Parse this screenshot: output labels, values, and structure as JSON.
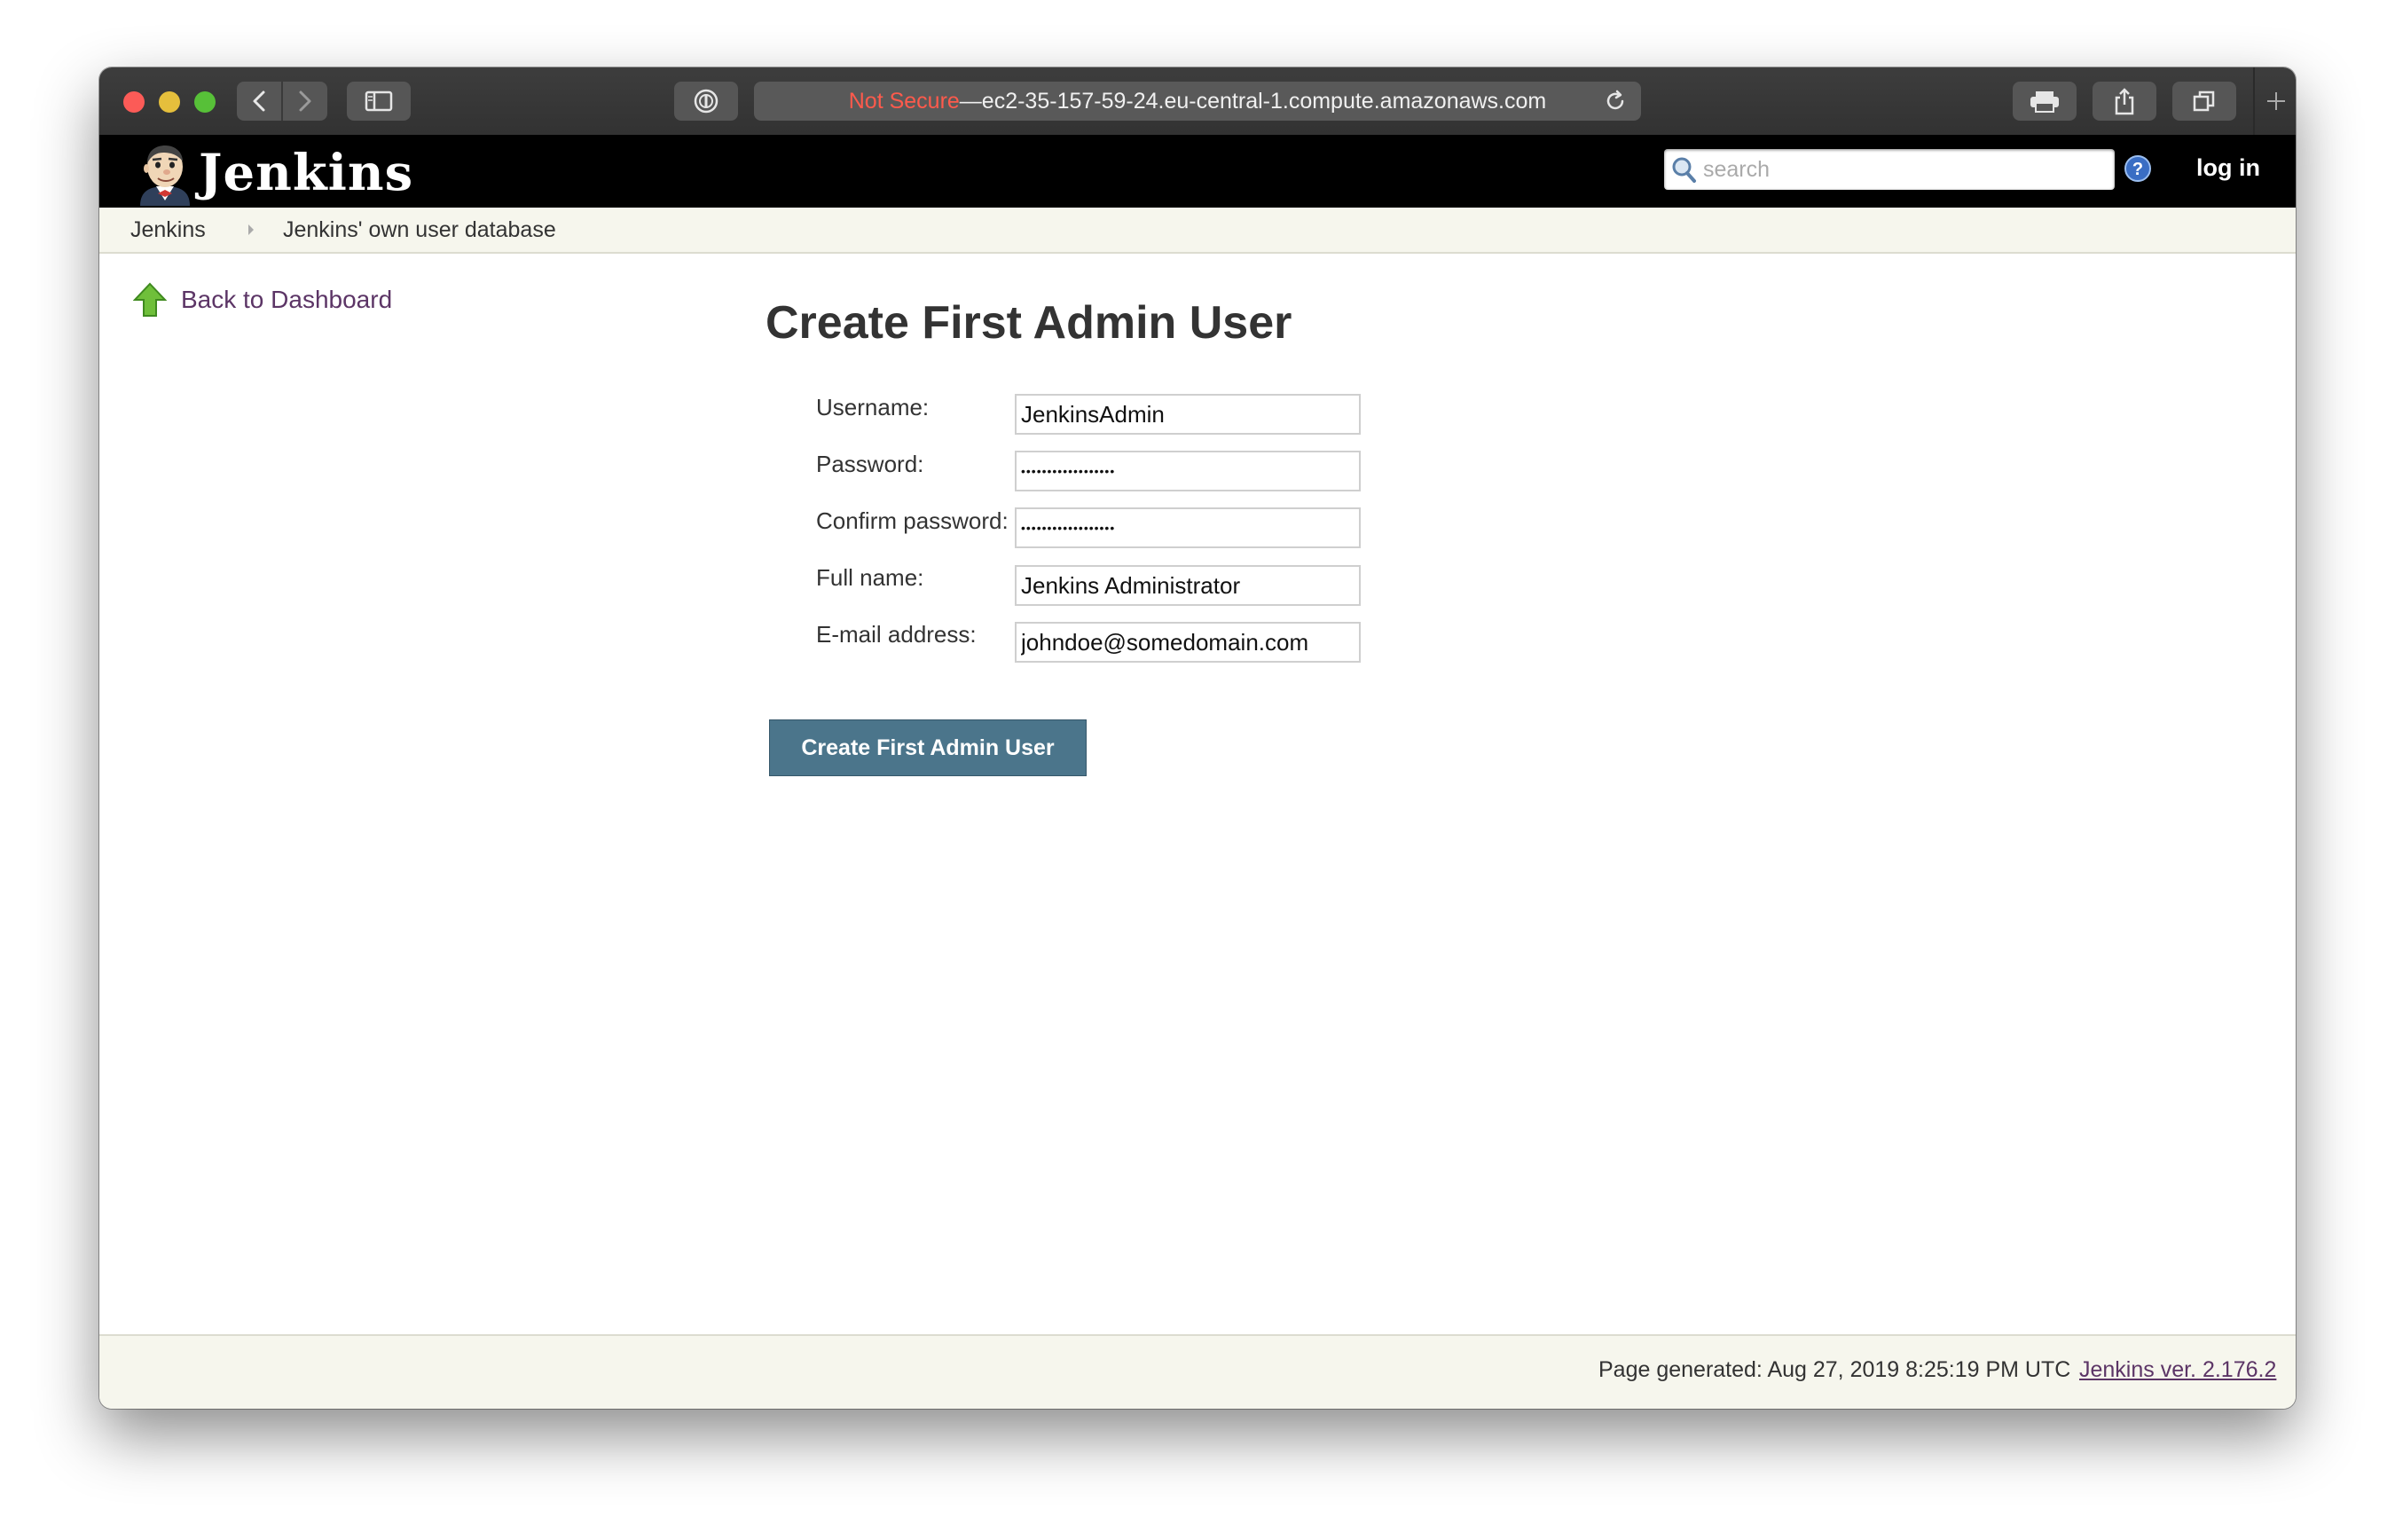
{
  "browser": {
    "url_security": "Not Secure",
    "url_separator": " — ",
    "url_host": "ec2-35-157-59-24.eu-central-1.compute.amazonaws.com"
  },
  "header": {
    "brand": "Jenkins",
    "search_placeholder": "search",
    "login_label": "log in"
  },
  "breadcrumbs": [
    "Jenkins",
    "Jenkins' own user database"
  ],
  "side_panel": {
    "back_label": "Back to Dashboard"
  },
  "form": {
    "title": "Create First Admin User",
    "username_label": "Username:",
    "username_value": "JenkinsAdmin",
    "password_label": "Password:",
    "password_value": "••••••••••••••••••",
    "confirm_label": "Confirm password:",
    "confirm_value": "••••••••••••••••••",
    "fullname_label": "Full name:",
    "fullname_value": "Jenkins Administrator",
    "email_label": "E-mail address:",
    "email_value": "johndoe@somedomain.com",
    "submit_label": "Create First Admin User"
  },
  "footer": {
    "generated": "Page generated: Aug 27, 2019 8:25:19 PM UTC",
    "version": "Jenkins ver. 2.176.2"
  },
  "colors": {
    "header_bg": "#000000",
    "breadcrumb_bg": "#f6f6ed",
    "link": "#5c3566",
    "button": "#4b758b",
    "not_secure": "#ff5a4c"
  },
  "icons": [
    "close-window-dot",
    "minimize-window-dot",
    "zoom-window-dot",
    "back-arrow-icon",
    "forward-arrow-icon",
    "sidebar-icon",
    "password-manager-icon",
    "reload-icon",
    "print-icon",
    "share-icon",
    "tabs-overview-icon",
    "new-tab-plus-icon",
    "jenkins-butler-logo",
    "search-icon",
    "help-icon",
    "breadcrumb-arrow-icon",
    "up-arrow-icon"
  ]
}
